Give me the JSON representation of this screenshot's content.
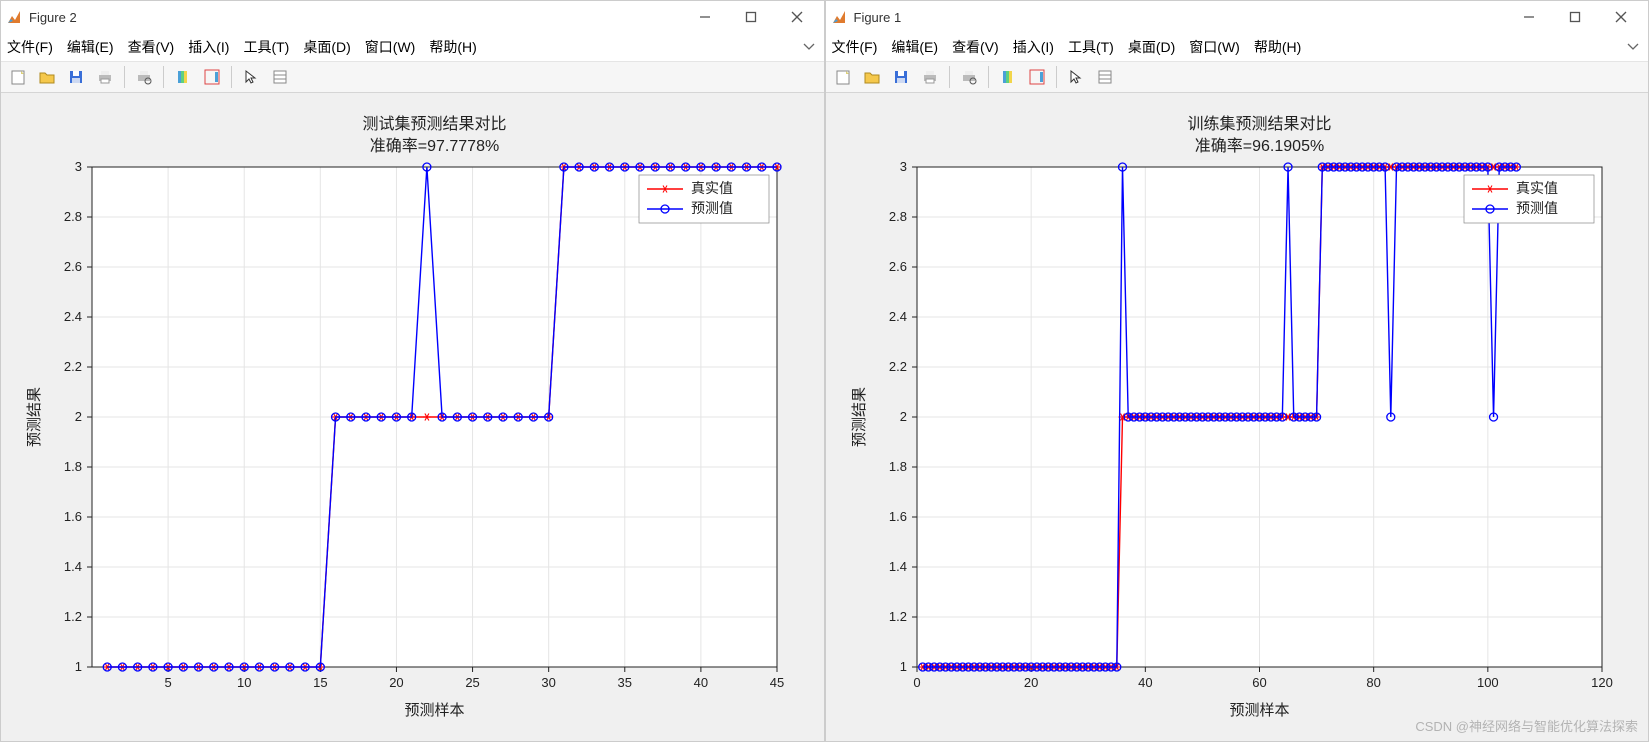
{
  "figures": [
    {
      "id": "fig2",
      "win_title": "Figure 2",
      "title": "测试集预测结果对比",
      "subtitle": "准确率=97.7778%",
      "xlabel": "预测样本",
      "ylabel": "预测结果",
      "legend": {
        "real": "真实值",
        "pred": "预测值"
      },
      "xlim": [
        0,
        45
      ],
      "ylim": [
        1,
        3
      ],
      "xticks": [
        5,
        10,
        15,
        20,
        25,
        30,
        35,
        40,
        45
      ],
      "yticks": [
        1,
        1.2,
        1.4,
        1.6,
        1.8,
        2,
        2.2,
        2.4,
        2.6,
        2.8,
        3
      ]
    },
    {
      "id": "fig1",
      "win_title": "Figure 1",
      "title": "训练集预测结果对比",
      "subtitle": "准确率=96.1905%",
      "xlabel": "预测样本",
      "ylabel": "预测结果",
      "legend": {
        "real": "真实值",
        "pred": "预测值"
      },
      "xlim": [
        0,
        120
      ],
      "ylim": [
        1,
        3
      ],
      "xticks": [
        0,
        20,
        40,
        60,
        80,
        100,
        120
      ],
      "yticks": [
        1,
        1.2,
        1.4,
        1.6,
        1.8,
        2,
        2.2,
        2.4,
        2.6,
        2.8,
        3
      ]
    }
  ],
  "menus": {
    "file": "文件(F)",
    "edit": "编辑(E)",
    "view": "查看(V)",
    "insert": "插入(I)",
    "tools": "工具(T)",
    "desktop": "桌面(D)",
    "window": "窗口(W)",
    "help": "帮助(H)"
  },
  "watermark": "CSDN @神经网络与智能优化算法探索",
  "colors": {
    "real": "#ff0000",
    "pred": "#0000ff",
    "grid": "#e5e5e5",
    "axis": "#222222"
  },
  "chart_data": [
    {
      "figure": "Figure 2",
      "type": "line",
      "title": "测试集预测结果对比",
      "subtitle_accuracy": 97.7778,
      "xlabel": "预测样本",
      "ylabel": "预测结果",
      "xlim": [
        0,
        45
      ],
      "ylim": [
        1,
        3
      ],
      "x": [
        1,
        2,
        3,
        4,
        5,
        6,
        7,
        8,
        9,
        10,
        11,
        12,
        13,
        14,
        15,
        16,
        17,
        18,
        19,
        20,
        21,
        22,
        23,
        24,
        25,
        26,
        27,
        28,
        29,
        30,
        31,
        32,
        33,
        34,
        35,
        36,
        37,
        38,
        39,
        40,
        41,
        42,
        43,
        44,
        45
      ],
      "series": [
        {
          "name": "真实值",
          "marker": "star",
          "color": "#ff0000",
          "values": [
            1,
            1,
            1,
            1,
            1,
            1,
            1,
            1,
            1,
            1,
            1,
            1,
            1,
            1,
            1,
            2,
            2,
            2,
            2,
            2,
            2,
            2,
            2,
            2,
            2,
            2,
            2,
            2,
            2,
            2,
            3,
            3,
            3,
            3,
            3,
            3,
            3,
            3,
            3,
            3,
            3,
            3,
            3,
            3,
            3
          ]
        },
        {
          "name": "预测值",
          "marker": "circle",
          "color": "#0000ff",
          "values": [
            1,
            1,
            1,
            1,
            1,
            1,
            1,
            1,
            1,
            1,
            1,
            1,
            1,
            1,
            1,
            2,
            2,
            2,
            2,
            2,
            2,
            3,
            2,
            2,
            2,
            2,
            2,
            2,
            2,
            2,
            3,
            3,
            3,
            3,
            3,
            3,
            3,
            3,
            3,
            3,
            3,
            3,
            3,
            3,
            3
          ]
        }
      ],
      "legend_position": "upper-right"
    },
    {
      "figure": "Figure 1",
      "type": "line",
      "title": "训练集预测结果对比",
      "subtitle_accuracy": 96.1905,
      "xlabel": "预测样本",
      "ylabel": "预测结果",
      "xlim": [
        0,
        120
      ],
      "ylim": [
        1,
        3
      ],
      "x": [
        1,
        2,
        3,
        4,
        5,
        6,
        7,
        8,
        9,
        10,
        11,
        12,
        13,
        14,
        15,
        16,
        17,
        18,
        19,
        20,
        21,
        22,
        23,
        24,
        25,
        26,
        27,
        28,
        29,
        30,
        31,
        32,
        33,
        34,
        35,
        36,
        37,
        38,
        39,
        40,
        41,
        42,
        43,
        44,
        45,
        46,
        47,
        48,
        49,
        50,
        51,
        52,
        53,
        54,
        55,
        56,
        57,
        58,
        59,
        60,
        61,
        62,
        63,
        64,
        65,
        66,
        67,
        68,
        69,
        70,
        71,
        72,
        73,
        74,
        75,
        76,
        77,
        78,
        79,
        80,
        81,
        82,
        83,
        84,
        85,
        86,
        87,
        88,
        89,
        90,
        91,
        92,
        93,
        94,
        95,
        96,
        97,
        98,
        99,
        100,
        101,
        102,
        103,
        104,
        105
      ],
      "series": [
        {
          "name": "真实值",
          "marker": "star",
          "color": "#ff0000",
          "values": [
            1,
            1,
            1,
            1,
            1,
            1,
            1,
            1,
            1,
            1,
            1,
            1,
            1,
            1,
            1,
            1,
            1,
            1,
            1,
            1,
            1,
            1,
            1,
            1,
            1,
            1,
            1,
            1,
            1,
            1,
            1,
            1,
            1,
            1,
            1,
            2,
            2,
            2,
            2,
            2,
            2,
            2,
            2,
            2,
            2,
            2,
            2,
            2,
            2,
            2,
            2,
            2,
            2,
            2,
            2,
            2,
            2,
            2,
            2,
            2,
            2,
            2,
            2,
            2,
            2,
            2,
            2,
            2,
            2,
            2,
            3,
            3,
            3,
            3,
            3,
            3,
            3,
            3,
            3,
            3,
            3,
            3,
            3,
            3,
            3,
            3,
            3,
            3,
            3,
            3,
            3,
            3,
            3,
            3,
            3,
            3,
            3,
            3,
            3,
            3,
            3,
            3,
            3,
            3,
            3
          ]
        },
        {
          "name": "预测值",
          "marker": "circle",
          "color": "#0000ff",
          "values": [
            1,
            1,
            1,
            1,
            1,
            1,
            1,
            1,
            1,
            1,
            1,
            1,
            1,
            1,
            1,
            1,
            1,
            1,
            1,
            1,
            1,
            1,
            1,
            1,
            1,
            1,
            1,
            1,
            1,
            1,
            1,
            1,
            1,
            1,
            1,
            3,
            2,
            2,
            2,
            2,
            2,
            2,
            2,
            2,
            2,
            2,
            2,
            2,
            2,
            2,
            2,
            2,
            2,
            2,
            2,
            2,
            2,
            2,
            2,
            2,
            2,
            2,
            2,
            2,
            3,
            2,
            2,
            2,
            2,
            2,
            3,
            3,
            3,
            3,
            3,
            3,
            3,
            3,
            3,
            3,
            3,
            3,
            2,
            3,
            3,
            3,
            3,
            3,
            3,
            3,
            3,
            3,
            3,
            3,
            3,
            3,
            3,
            3,
            3,
            3,
            2,
            3,
            3,
            3,
            3
          ]
        }
      ],
      "legend_position": "upper-right"
    }
  ]
}
